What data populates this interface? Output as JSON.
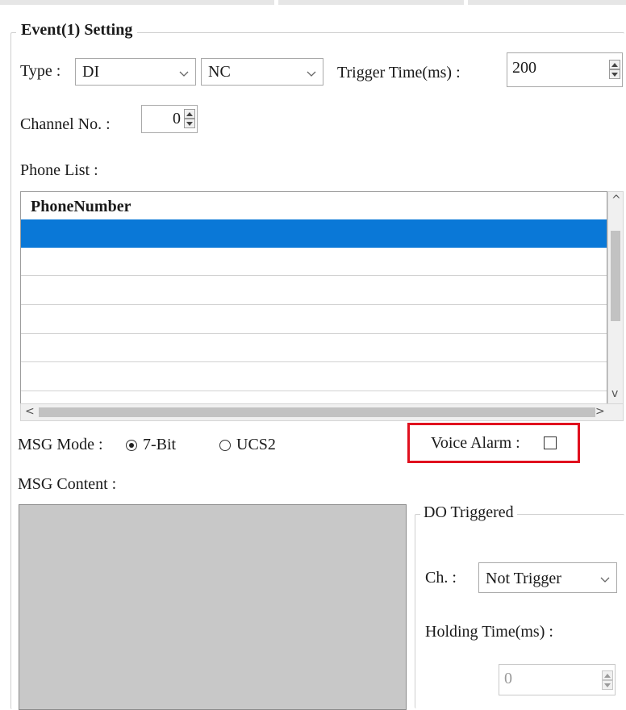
{
  "group_title": "Event(1) Setting",
  "type": {
    "label": "Type :",
    "value1": "DI",
    "value2": "NC"
  },
  "trigger_time": {
    "label": "Trigger Time(ms) :",
    "value": "200"
  },
  "channel": {
    "label": "Channel No. :",
    "value": "0"
  },
  "phone_list": {
    "label": "Phone List :",
    "columns": [
      "PhoneNumber"
    ],
    "rows": [
      "",
      "",
      "",
      "",
      "",
      ""
    ],
    "selected_row": 0
  },
  "msg_mode": {
    "label": "MSG Mode :",
    "options": [
      "7-Bit",
      "UCS2"
    ],
    "selected": "7-Bit"
  },
  "voice_alarm": {
    "label": "Voice Alarm :",
    "checked": false
  },
  "msg_content": {
    "label": "MSG Content :"
  },
  "do_triggered": {
    "title": "DO Triggered",
    "ch_label": "Ch. :",
    "ch_value": "Not Trigger",
    "holding_label": "Holding Time(ms) :",
    "holding_value": "0"
  },
  "colors": {
    "selection": "#0a78d7",
    "highlight_border": "#e0101e",
    "msg_box_bg": "#c8c8c8"
  },
  "icons": [
    "chevron-down-icon",
    "spin-up-icon",
    "spin-down-icon",
    "scroll-left-icon",
    "scroll-right-icon",
    "scroll-up-icon",
    "scroll-down-icon"
  ]
}
